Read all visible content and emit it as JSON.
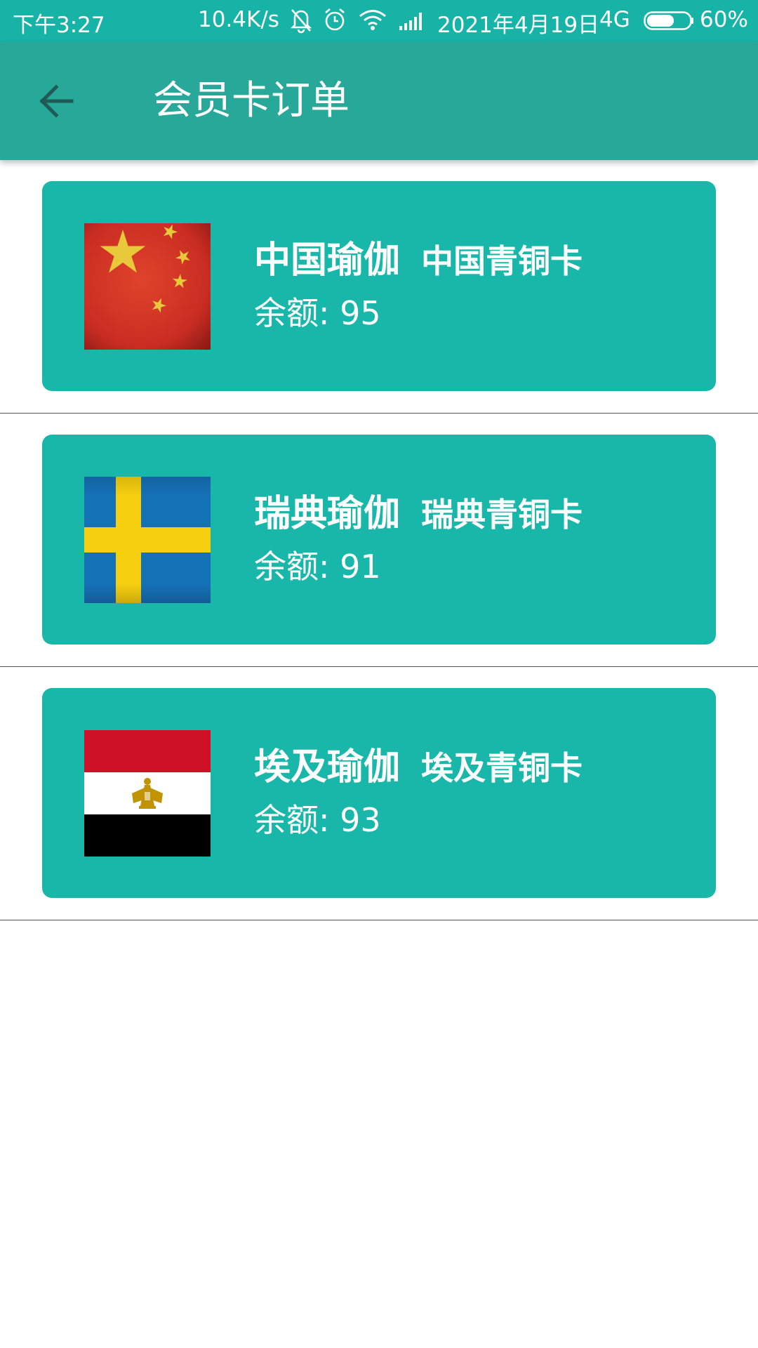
{
  "status_bar": {
    "time": "下午3:27",
    "net_speed": "10.4K/s",
    "date": "2021年4月19日",
    "network": "4G",
    "battery": "60%",
    "icons": [
      "mute-bell-icon",
      "alarm-icon",
      "wifi-icon",
      "signal-icon",
      "battery-icon"
    ]
  },
  "app_bar": {
    "back_icon": "arrow-left-icon",
    "title": "会员卡订单"
  },
  "colors": {
    "status_bar": "#17b3a7",
    "app_bar": "#27a899",
    "card": "#18b7a9",
    "back_arrow": "#1e5c55"
  },
  "cards": [
    {
      "flag": "china-flag",
      "brand": "中国瑜伽",
      "tier": "中国青铜卡",
      "balance_label": "余额:",
      "balance": "95"
    },
    {
      "flag": "sweden-flag",
      "brand": "瑞典瑜伽",
      "tier": "瑞典青铜卡",
      "balance_label": "余额:",
      "balance": "91"
    },
    {
      "flag": "egypt-flag",
      "brand": "埃及瑜伽",
      "tier": "埃及青铜卡",
      "balance_label": "余额:",
      "balance": "93"
    }
  ]
}
